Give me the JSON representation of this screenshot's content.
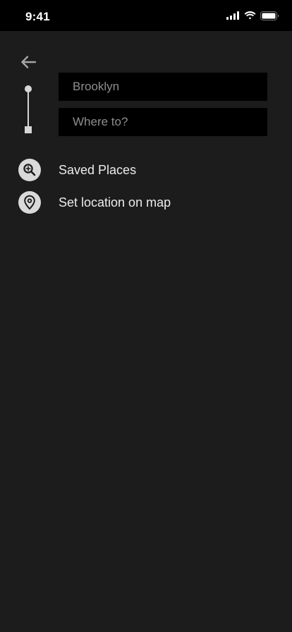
{
  "status_bar": {
    "time": "9:41",
    "icons": [
      "cellular-signal-icon",
      "wifi-icon",
      "battery-icon"
    ]
  },
  "header": {
    "back_icon": "arrow-left-icon"
  },
  "route": {
    "origin": {
      "value": "",
      "placeholder": "Brooklyn"
    },
    "destination": {
      "value": "",
      "placeholder": "Where to?"
    }
  },
  "menu": {
    "items": [
      {
        "label": "Saved Places",
        "icon": "saved-places-search-icon"
      },
      {
        "label": "Set location on map",
        "icon": "map-pin-icon"
      }
    ]
  },
  "colors": {
    "background": "#1c1c1c",
    "status_bar": "#000000",
    "input_background": "#000000",
    "icon_circle": "#d9d9d9",
    "text": "#ececec",
    "placeholder": "#8e8e8e"
  }
}
